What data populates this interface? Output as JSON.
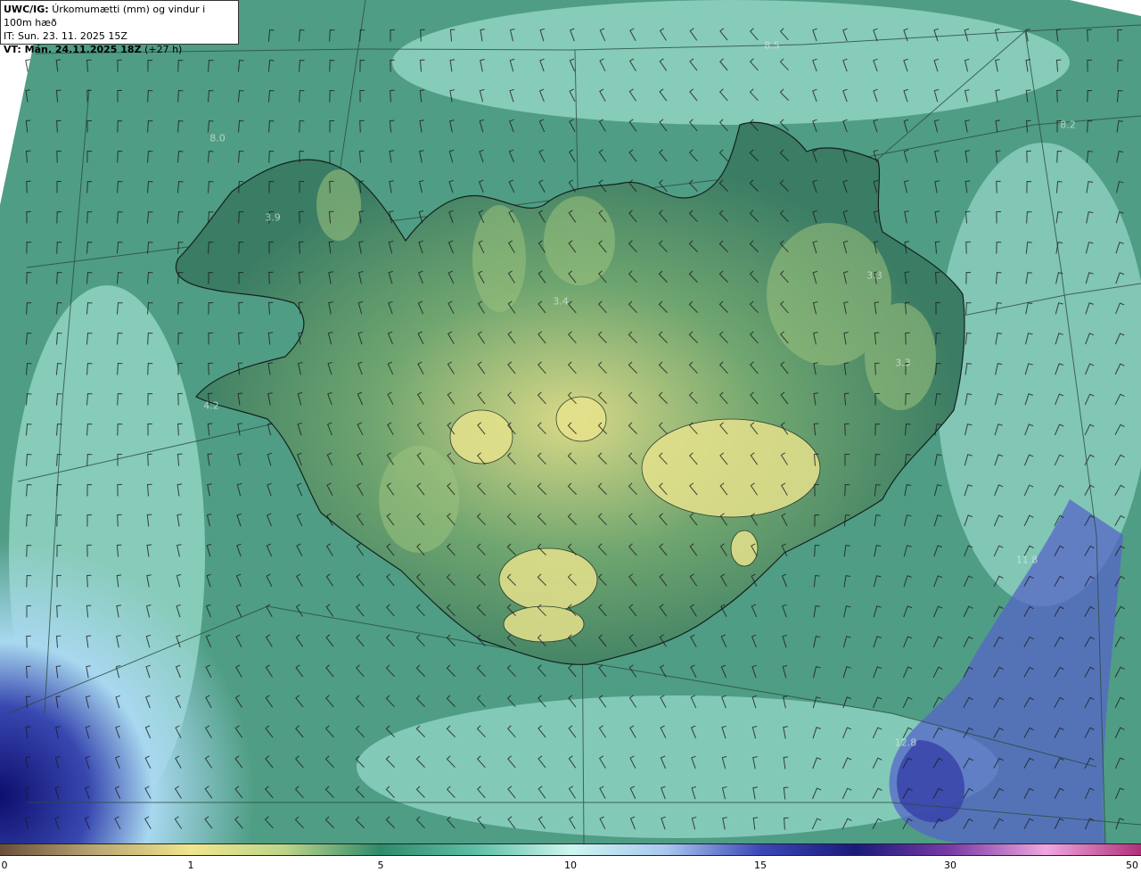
{
  "header": {
    "product": "UWC/IG:",
    "title": "Úrkomumætti (mm) og vindur i 100m hæð",
    "it_line": "IT: Sun. 23. 11. 2025 15Z",
    "vt_label": "VT: Mán. 24.11.2025 18Z",
    "vt_offset": "(+27 h)"
  },
  "map_labels": [
    {
      "text": "8.0"
    },
    {
      "text": "3.9"
    },
    {
      "text": "4.2"
    },
    {
      "text": "3.4"
    },
    {
      "text": "3.3"
    },
    {
      "text": "3.3"
    },
    {
      "text": "8.2"
    },
    {
      "text": "8.5"
    },
    {
      "text": "11.8"
    },
    {
      "text": "12.8"
    }
  ],
  "colorbar": {
    "ticks": [
      "0",
      "1",
      "5",
      "10",
      "15",
      "30",
      "50"
    ],
    "colors": [
      "#6a4e3a",
      "#b9a772",
      "#f0e68c",
      "#bcd58a",
      "#2e8b6a",
      "#5dbfa6",
      "#cdf6f0",
      "#a9c8ef",
      "#3b47b6",
      "#1a1a7a",
      "#7a3aa6",
      "#f0a6e0",
      "#b0307a"
    ]
  },
  "colors": {
    "land_low": "#3f7f68",
    "land_high": "#e4e18e",
    "sea": "#5fae95",
    "sea_light": "#b6f0e6",
    "heavy": "#1f1f95"
  }
}
